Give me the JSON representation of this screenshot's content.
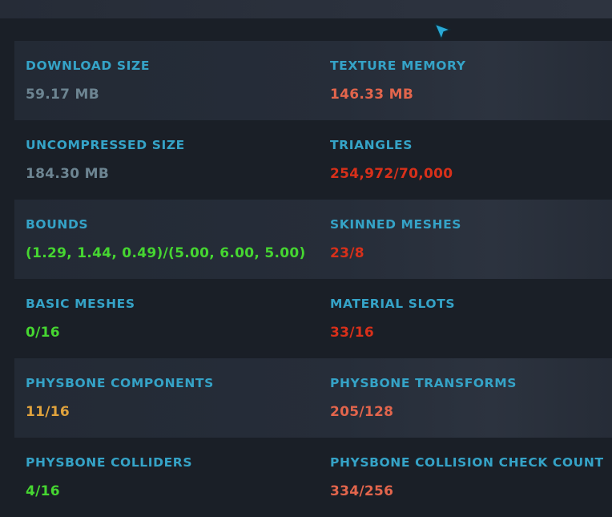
{
  "colors": {
    "label": "#35a3c7",
    "neutral": "#6d8592",
    "warning": "#e2654c",
    "bad": "#d8301a",
    "good": "#46d631",
    "medium": "#e1a33d",
    "cursor": "#29a9d6"
  },
  "icons": {
    "cursor": "mouse-pointer-icon"
  },
  "stats": [
    {
      "left": {
        "label": "DOWNLOAD SIZE",
        "value": "59.17 MB"
      },
      "right": {
        "label": "TEXTURE MEMORY",
        "value": "146.33 MB"
      }
    },
    {
      "left": {
        "label": "UNCOMPRESSED SIZE",
        "value": "184.30 MB"
      },
      "right": {
        "label": "TRIANGLES",
        "value": "254,972/70,000"
      }
    },
    {
      "left": {
        "label": "BOUNDS",
        "value": "(1.29, 1.44, 0.49)/(5.00, 6.00, 5.00)"
      },
      "right": {
        "label": "SKINNED MESHES",
        "value": "23/8"
      }
    },
    {
      "left": {
        "label": "BASIC MESHES",
        "value": "0/16"
      },
      "right": {
        "label": "MATERIAL SLOTS",
        "value": "33/16"
      }
    },
    {
      "left": {
        "label": "PHYSBONE COMPONENTS",
        "value": "11/16"
      },
      "right": {
        "label": "PHYSBONE TRANSFORMS",
        "value": "205/128"
      }
    },
    {
      "left": {
        "label": "PHYSBONE COLLIDERS",
        "value": "4/16"
      },
      "right": {
        "label": "PHYSBONE COLLISION CHECK COUNT",
        "value": "334/256"
      }
    }
  ]
}
